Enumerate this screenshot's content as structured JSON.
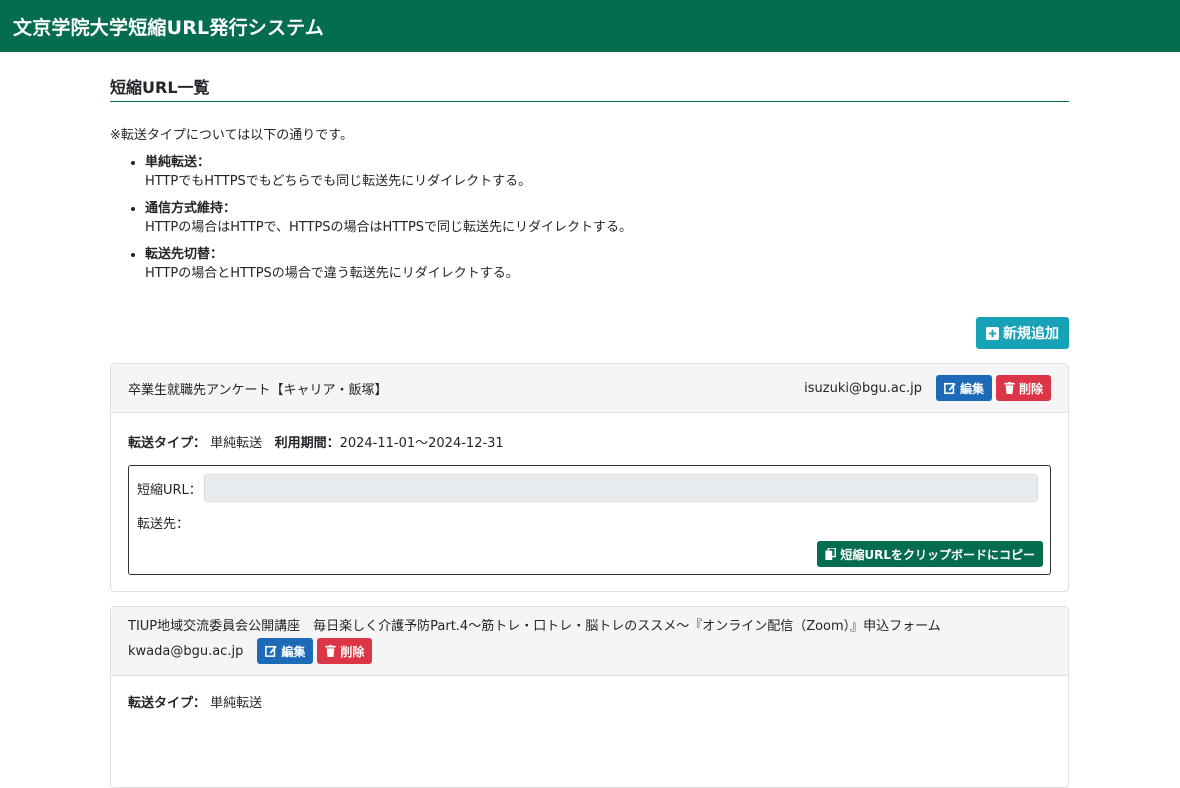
{
  "app": {
    "title": "文京学院大学短縮URL発行システム"
  },
  "section": {
    "title": "短縮URL一覧"
  },
  "note": "※転送タイプについては以下の通りです。",
  "transfer_types": [
    {
      "name": "単純転送：",
      "desc": "HTTPでもHTTPSでもどちらでも同じ転送先にリダイレクトする。"
    },
    {
      "name": "通信方式維持：",
      "desc": "HTTPの場合はHTTPで、HTTPSの場合はHTTPSで同じ転送先にリダイレクトする。"
    },
    {
      "name": "転送先切替：",
      "desc": "HTTPの場合とHTTPSの場合で違う転送先にリダイレクトする。"
    }
  ],
  "buttons": {
    "add": "新規追加",
    "edit": "編集",
    "delete": "削除",
    "copy": "短縮URLをクリップボードにコピー"
  },
  "labels": {
    "transfer_type": "転送タイプ：",
    "period": "利用期間：",
    "short_url": "短縮URL：",
    "destination": "転送先："
  },
  "entries": [
    {
      "title": "卒業生就職先アンケート【キャリア・飯塚】",
      "owner": "isuzuki@bgu.ac.jp",
      "transfer_type": "単純転送",
      "period": "2024-11-01〜2024-12-31",
      "short_url": "",
      "destination": ""
    },
    {
      "title": "TIUP地域交流委員会公開講座　毎日楽しく介護予防Part.4〜筋トレ・口トレ・脳トレのススメ〜『オンライン配信（Zoom）』申込フォーム",
      "owner": "kwada@bgu.ac.jp",
      "transfer_type": "単純転送"
    }
  ],
  "colors": {
    "navbar": "#046d4f",
    "add_button": "#17a2b8",
    "edit_button": "#1d6bb8",
    "delete_button": "#dc3545",
    "copy_button": "#046d4f"
  },
  "icons": {
    "add": "plus-square-icon",
    "edit": "edit-icon",
    "delete": "trash-icon",
    "copy": "copy-icon"
  }
}
